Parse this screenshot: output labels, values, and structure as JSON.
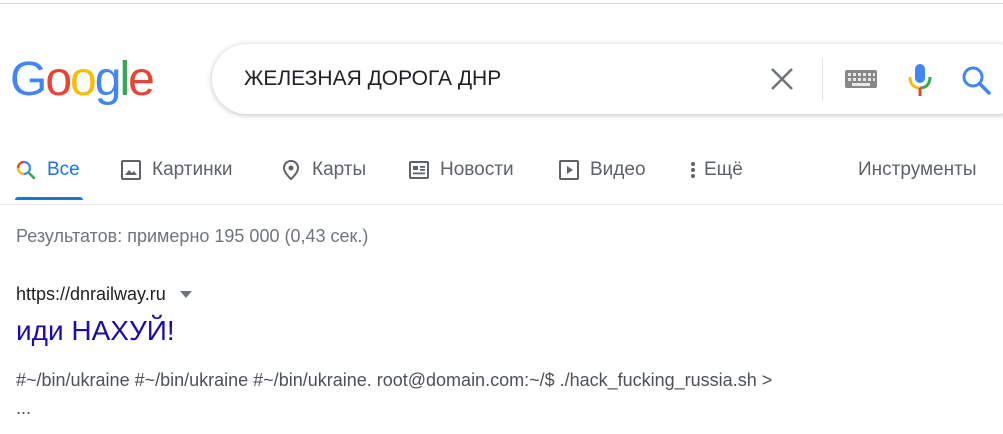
{
  "logo": {
    "letters": [
      "G",
      "o",
      "o",
      "g",
      "l",
      "e"
    ],
    "colors": [
      "#4285F4",
      "#EA4335",
      "#FBBC05",
      "#4285F4",
      "#34A853",
      "#EA4335"
    ]
  },
  "search": {
    "query": "ЖЕЛЕЗНАЯ ДОРОГА ДНР"
  },
  "tabs": [
    {
      "label": "Все",
      "icon": "search-icon",
      "active": true
    },
    {
      "label": "Картинки",
      "icon": "image-icon",
      "active": false
    },
    {
      "label": "Карты",
      "icon": "map-pin-icon",
      "active": false
    },
    {
      "label": "Новости",
      "icon": "news-icon",
      "active": false
    },
    {
      "label": "Видео",
      "icon": "video-icon",
      "active": false
    },
    {
      "label": "Ещё",
      "icon": "more-vert-icon",
      "active": false
    }
  ],
  "tools_label": "Инструменты",
  "stats": "Результатов: примерно 195 000 (0,43 сек.)",
  "result": {
    "url": "https://dnrailway.ru",
    "title": "иди НАХУЙ!",
    "snippet_line1": "#~/bin/ukraine #~/bin/ukraine #~/bin/ukraine. root@domain.com:~/$ ./hack_fucking_russia.sh >",
    "snippet_line2": "..."
  },
  "colors": {
    "accent": "#1a73e8",
    "link": "#1a0dab",
    "muted": "#70757a"
  }
}
